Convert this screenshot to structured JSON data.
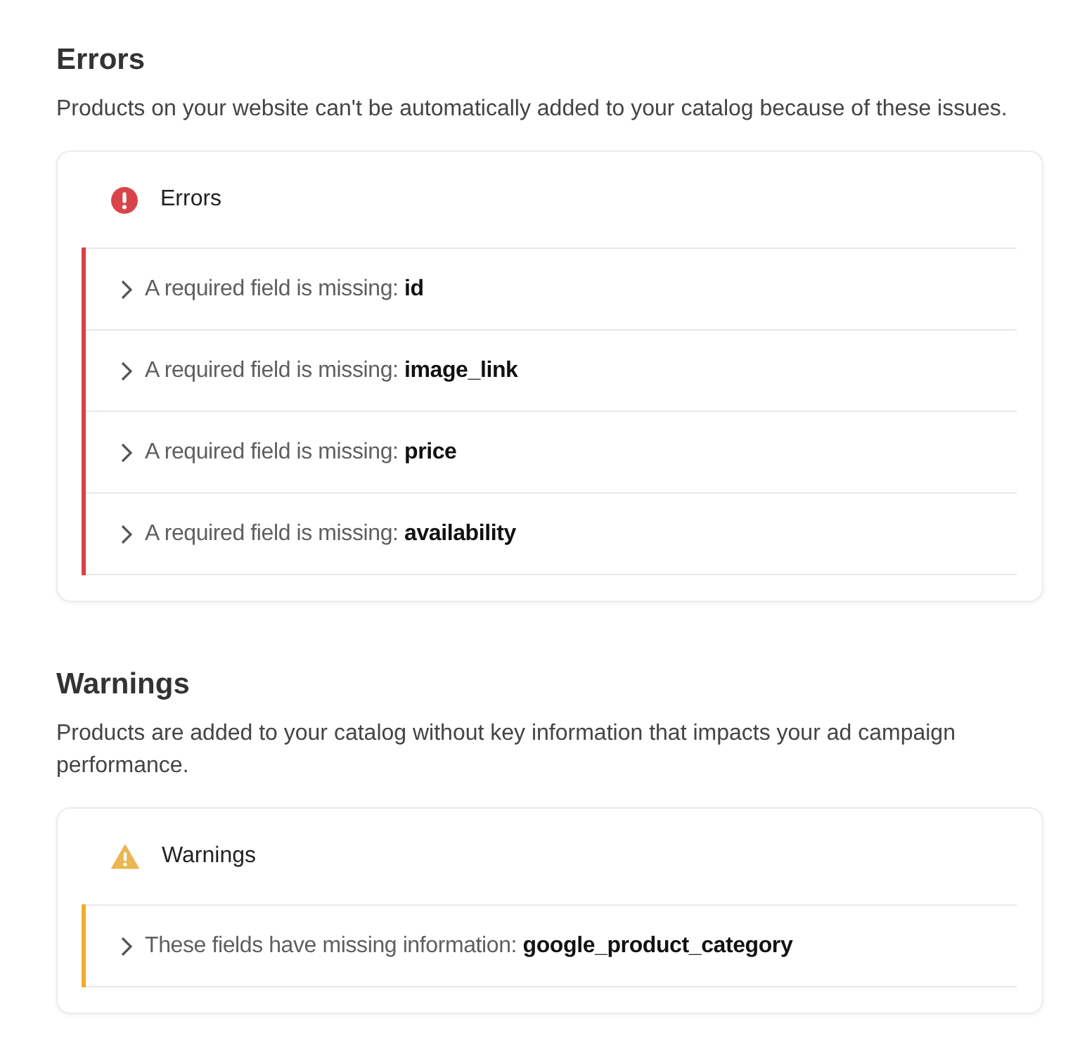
{
  "sections": [
    {
      "kind": "error",
      "title": "Errors",
      "description": "Products on your website can't be automatically added to your catalog because of these issues.",
      "card": {
        "header": "Errors",
        "items": [
          {
            "text": "A required field is missing: **id**",
            "expanded": false
          },
          {
            "text": "A required field is missing: **image_link**",
            "expanded": false
          },
          {
            "text": "A required field is missing: **price**",
            "expanded": false
          },
          {
            "text": "A required field is missing: **availability**",
            "expanded": false
          }
        ]
      }
    },
    {
      "kind": "warning",
      "title": "Warnings",
      "description": "Products are added to your catalog without key information that impacts your ad campaign performance.",
      "card": {
        "header": "Warnings",
        "items": [
          {
            "text": "These fields have missing information: **google_product_category**",
            "expanded": false
          }
        ]
      }
    }
  ]
}
